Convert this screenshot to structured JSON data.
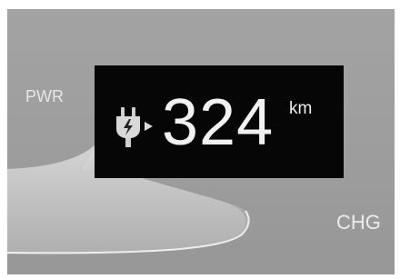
{
  "gauge": {
    "power_label": "PWR",
    "charge_label": "CHG"
  },
  "range_display": {
    "icon": "ev-plug-icon",
    "value": "324",
    "unit": "km"
  },
  "colors": {
    "panel_background": "#a0a0a0",
    "display_background": "#060606",
    "display_text": "#f2f2f2"
  }
}
